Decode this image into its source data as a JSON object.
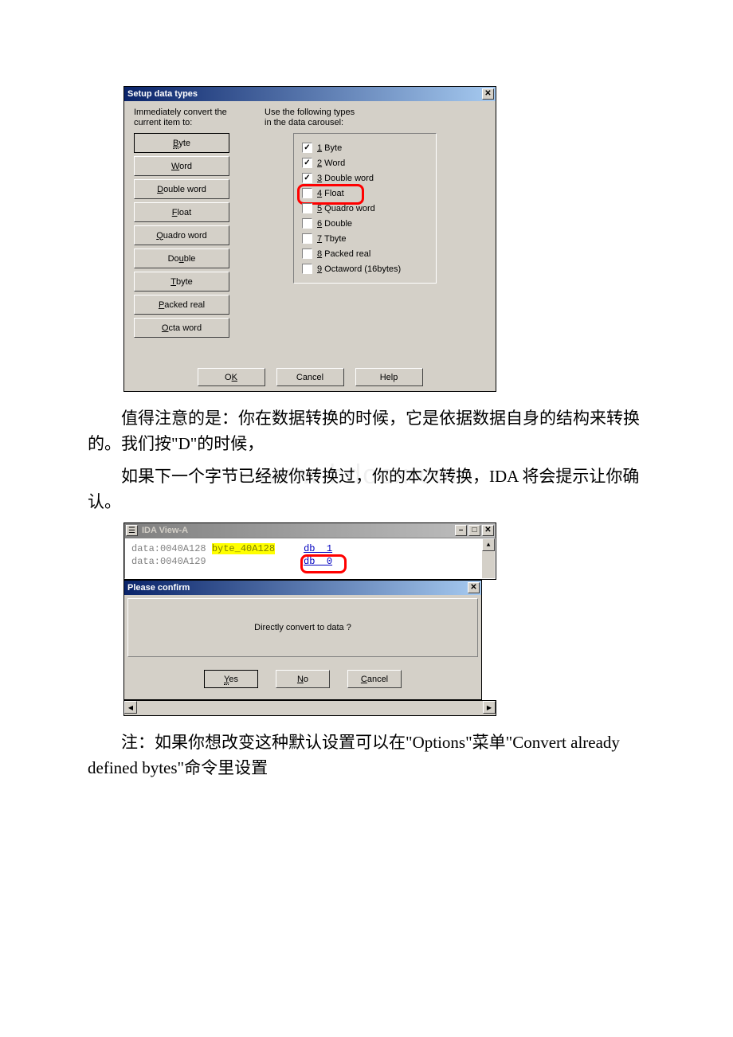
{
  "dialog1": {
    "title": "Setup data types",
    "left_header1": "Immediately convert the",
    "left_header2": "current item to:",
    "right_header1": "Use the following types",
    "right_header2": "in the data carousel:",
    "buttons": {
      "byte": "Byte",
      "byte_u": "B",
      "word": "Word",
      "word_u": "W",
      "dword": "Double word",
      "dword_u": "D",
      "float": "Float",
      "float_u": "F",
      "qword": "Quadro word",
      "qword_u": "Q",
      "double": "Double",
      "double_u": "u",
      "tbyte": "Tbyte",
      "tbyte_u": "T",
      "packed": "Packed real",
      "packed_u": "P",
      "octa": "Octa word",
      "octa_u": "O"
    },
    "carousel": {
      "byte": "1 Byte",
      "byte_u": "1",
      "word": "2 Word",
      "word_u": "2",
      "dword": "3 Double word",
      "dword_u": "3",
      "float": "4 Float",
      "float_u": "4",
      "qword": "5 Quadro word",
      "qword_u": "5",
      "double": "6 Double",
      "double_u": "6",
      "tbyte": "7 Tbyte",
      "tbyte_u": "7",
      "packed": "8 Packed real",
      "packed_u": "8",
      "octa": "9 Octaword (16bytes)",
      "octa_u": "9"
    },
    "ok": "OK",
    "ok_u": "K",
    "cancel": "Cancel",
    "help": "Help"
  },
  "para1": "值得注意的是：你在数据转换的时候，它是依据数据自身的结构来转换的。我们按\"D\"的时候，",
  "para2": "如果下一个字节已经被你转换过，你的本次转换，IDA 将会提示让你确认。",
  "watermark": "www.bdocx.com",
  "idaview": {
    "title": "IDA View-A",
    "row1_addr": "data:0040A128",
    "row1_name": "byte_40A128",
    "row1_db": "db  1",
    "row2_addr": "data:0040A129",
    "row2_db": "db  0"
  },
  "confirm": {
    "title": "Please confirm",
    "message": "Directly convert to data ?",
    "yes": "Yes",
    "yes_u": "Y",
    "no": "No",
    "no_u": "N",
    "cancel": "Cancel",
    "cancel_u": "C"
  },
  "para3": "注：如果你想改变这种默认设置可以在\"Options\"菜单\"Convert already defined bytes\"命令里设置"
}
